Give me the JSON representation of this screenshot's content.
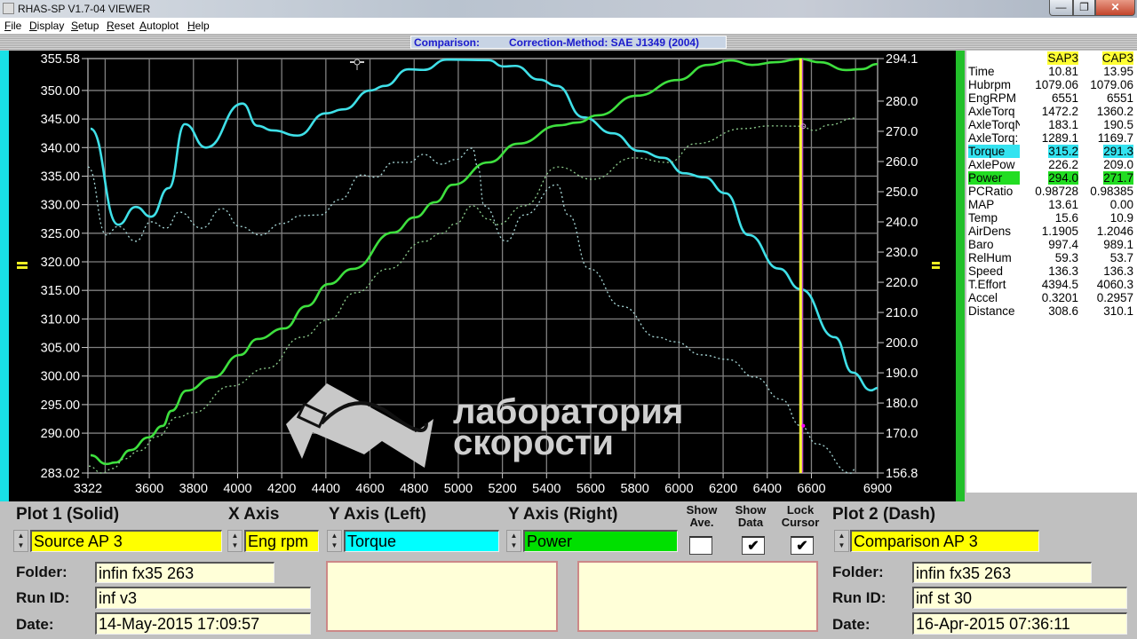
{
  "window": {
    "title": "RHAS-SP V1.7-04  VIEWER",
    "controls": {
      "minimize": "—",
      "restore": "❐",
      "close": "✕"
    }
  },
  "menu": [
    "File",
    "Display",
    "Setup",
    "Reset",
    "Autoplot",
    "Help"
  ],
  "status": {
    "mode": "Comparison:",
    "correction": "Correction-Method: SAE J1349 (2004)"
  },
  "watermark": {
    "line1": "лаборатория",
    "line2": "скорости"
  },
  "table": {
    "headers": [
      "SAP3",
      "CAP3"
    ],
    "rows": [
      {
        "label": "Time",
        "a": "10.81",
        "b": "13.95"
      },
      {
        "label": "Hubrpm",
        "a": "1079.06",
        "b": "1079.06"
      },
      {
        "label": "EngRPM",
        "a": "6551",
        "b": "6551"
      },
      {
        "label": "AxleTorq",
        "a": "1472.2",
        "b": "1360.2"
      },
      {
        "label": "AxleTorqN",
        "a": "183.1",
        "b": "190.5"
      },
      {
        "label": "AxleTorq:",
        "a": "1289.1",
        "b": "1169.7"
      },
      {
        "label": "Torque",
        "a": "315.2",
        "b": "291.3",
        "hl": "cyan"
      },
      {
        "label": "AxlePow",
        "a": "226.2",
        "b": "209.0"
      },
      {
        "label": "Power",
        "a": "294.0",
        "b": "271.7",
        "hl": "green"
      },
      {
        "label": "PCRatio",
        "a": "0.98728",
        "b": "0.98385"
      },
      {
        "label": "MAP",
        "a": "13.61",
        "b": "0.00"
      },
      {
        "label": "Temp",
        "a": "15.6",
        "b": "10.9"
      },
      {
        "label": "AirDens",
        "a": "1.1905",
        "b": "1.2046"
      },
      {
        "label": "Baro",
        "a": "997.4",
        "b": "989.1"
      },
      {
        "label": "RelHum",
        "a": "59.3",
        "b": "53.7"
      },
      {
        "label": "Speed",
        "a": "136.3",
        "b": "136.3"
      },
      {
        "label": "T.Effort",
        "a": "4394.5",
        "b": "4060.3"
      },
      {
        "label": "Accel",
        "a": "0.3201",
        "b": "0.2957"
      },
      {
        "label": "Distance",
        "a": "308.6",
        "b": "310.1"
      }
    ]
  },
  "controls": {
    "plot1_title": "Plot 1 (Solid)",
    "xaxis_title": "X Axis",
    "yleft_title": "Y Axis (Left)",
    "yright_title": "Y Axis (Right)",
    "show_ave_1": "Show",
    "show_ave_2": "Ave.",
    "show_data_1": "Show",
    "show_data_2": "Data",
    "lock_cursor_1": "Lock",
    "lock_cursor_2": "Cursor",
    "plot2_title": "Plot 2 (Dash)",
    "plot1_source": "Source AP 3",
    "xaxis_value": "Eng rpm",
    "yleft_value": "Torque",
    "yright_value": "Power",
    "plot2_source": "Comparison AP 3",
    "show_ave": false,
    "show_data": true,
    "lock_cursor": true,
    "check_mark": "✔",
    "folder_label": "Folder:",
    "runid_label": "Run ID:",
    "date_label": "Date:",
    "plot1": {
      "folder": "infin fx35 263",
      "run_id": "inf v3",
      "date": "14-May-2015  17:09:57"
    },
    "plot2": {
      "folder": "infin fx35 263",
      "run_id": "inf st 30",
      "date": "16-Apr-2015  07:36:11"
    },
    "colors": {
      "plot": "#ffff00",
      "left": "#00ffff",
      "right": "#00e000"
    }
  },
  "chart_data": {
    "type": "line",
    "xlabel": "Eng rpm",
    "ylabel_left": "Torque",
    "ylabel_right": "Power",
    "xlim": [
      3322,
      6900
    ],
    "ylim_left": [
      283.02,
      355.58
    ],
    "ylim_right": [
      156.8,
      294.1
    ],
    "grid": true,
    "cursor_rpm": 6551,
    "x_ticks": [
      3322,
      3600,
      3800,
      4000,
      4200,
      4400,
      4600,
      4800,
      5000,
      5200,
      5400,
      5600,
      5800,
      6000,
      6200,
      6400,
      6600,
      6900
    ],
    "x_grid": [
      3400,
      3600,
      3800,
      4000,
      4200,
      4400,
      4600,
      4800,
      5000,
      5200,
      5400,
      5600,
      5800,
      6000,
      6200,
      6400,
      6600,
      6800
    ],
    "y_left_ticks": [
      "355.58",
      "350.00",
      "345.00",
      "340.00",
      "335.00",
      "330.00",
      "325.00",
      "320.00",
      "315.00",
      "310.00",
      "305.00",
      "300.00",
      "295.00",
      "290.00",
      "283.02"
    ],
    "y_right_ticks": [
      "294.1",
      "280.0",
      "270.0",
      "260.0",
      "250.0",
      "240.0",
      "230.0",
      "220.0",
      "210.0",
      "200.0",
      "190.0",
      "180.0",
      "170.0",
      "156.8"
    ],
    "series": [
      {
        "name": "Torque (Source AP 3)",
        "axis": "left",
        "style": "solid",
        "color": "#3fe0e8",
        "points": [
          [
            3334,
            343.3
          ],
          [
            3459,
            326.5
          ],
          [
            3539,
            329.6
          ],
          [
            3608,
            327.9
          ],
          [
            3688,
            332.9
          ],
          [
            3761,
            344.1
          ],
          [
            3857,
            340.0
          ],
          [
            4022,
            347.7
          ],
          [
            4091,
            343.8
          ],
          [
            4159,
            343.0
          ],
          [
            4272,
            342.1
          ],
          [
            4400,
            346.0
          ],
          [
            4481,
            346.7
          ],
          [
            4602,
            350.0
          ],
          [
            4666,
            350.8
          ],
          [
            4775,
            353.7
          ],
          [
            4843,
            353.6
          ],
          [
            4948,
            355.4
          ],
          [
            5137,
            355.3
          ],
          [
            5205,
            354.2
          ],
          [
            5258,
            354.3
          ],
          [
            5366,
            351.9
          ],
          [
            5447,
            350.8
          ],
          [
            5567,
            345.3
          ],
          [
            5700,
            342.5
          ],
          [
            5821,
            339.4
          ],
          [
            5930,
            338.2
          ],
          [
            6022,
            335.5
          ],
          [
            6115,
            334.8
          ],
          [
            6211,
            332.0
          ],
          [
            6316,
            324.7
          ],
          [
            6453,
            318.8
          ],
          [
            6551,
            315.2
          ],
          [
            6706,
            306.8
          ],
          [
            6787,
            300.6
          ],
          [
            6870,
            297.5
          ],
          [
            6900,
            297.9
          ]
        ]
      },
      {
        "name": "Power (Source AP 3)",
        "axis": "right",
        "style": "solid",
        "color": "#3ee03e",
        "points": [
          [
            3334,
            162.7
          ],
          [
            3406,
            159.8
          ],
          [
            3447,
            160.3
          ],
          [
            3515,
            164.4
          ],
          [
            3596,
            168.6
          ],
          [
            3660,
            172.4
          ],
          [
            3700,
            177.4
          ],
          [
            3769,
            184.1
          ],
          [
            3889,
            188.5
          ],
          [
            4010,
            195.9
          ],
          [
            4091,
            201.2
          ],
          [
            4211,
            204.7
          ],
          [
            4312,
            212.1
          ],
          [
            4413,
            219.4
          ],
          [
            4521,
            224.4
          ],
          [
            4706,
            236.5
          ],
          [
            4803,
            241.5
          ],
          [
            4895,
            246.5
          ],
          [
            4976,
            252.3
          ],
          [
            5137,
            259.7
          ],
          [
            5270,
            265.9
          ],
          [
            5459,
            272.0
          ],
          [
            5539,
            272.9
          ],
          [
            5632,
            275.3
          ],
          [
            5809,
            281.8
          ],
          [
            5994,
            287.0
          ],
          [
            6131,
            292.0
          ],
          [
            6235,
            293.5
          ],
          [
            6332,
            292.0
          ],
          [
            6437,
            292.9
          ],
          [
            6551,
            294.0
          ],
          [
            6638,
            292.9
          ],
          [
            6758,
            290.3
          ],
          [
            6827,
            290.6
          ],
          [
            6900,
            292.3
          ]
        ]
      },
      {
        "name": "Torque (Comparison AP 3)",
        "axis": "left",
        "style": "dash",
        "color": "#a8d8d8",
        "points": [
          [
            3322,
            336.6
          ],
          [
            3406,
            324.7
          ],
          [
            3459,
            326.2
          ],
          [
            3539,
            323.6
          ],
          [
            3608,
            327.0
          ],
          [
            3676,
            325.9
          ],
          [
            3736,
            328.7
          ],
          [
            3837,
            325.9
          ],
          [
            3930,
            329.3
          ],
          [
            4010,
            326.2
          ],
          [
            4103,
            324.7
          ],
          [
            4199,
            326.7
          ],
          [
            4292,
            328.1
          ],
          [
            4372,
            328.2
          ],
          [
            4465,
            330.9
          ],
          [
            4561,
            335.2
          ],
          [
            4626,
            334.8
          ],
          [
            4706,
            337.4
          ],
          [
            4775,
            337.4
          ],
          [
            4843,
            338.8
          ],
          [
            4924,
            337.1
          ],
          [
            4988,
            337.9
          ],
          [
            5064,
            339.9
          ],
          [
            5089,
            336.6
          ],
          [
            5117,
            329.8
          ],
          [
            5217,
            323.6
          ],
          [
            5298,
            328.2
          ],
          [
            5447,
            333.5
          ],
          [
            5499,
            328.2
          ],
          [
            5592,
            318.8
          ],
          [
            5741,
            312.2
          ],
          [
            5901,
            306.8
          ],
          [
            5982,
            306.0
          ],
          [
            6103,
            303.7
          ],
          [
            6223,
            302.9
          ],
          [
            6344,
            299.8
          ],
          [
            6465,
            295.9
          ],
          [
            6551,
            291.3
          ],
          [
            6626,
            288.1
          ],
          [
            6779,
            283.0
          ],
          [
            6799,
            283.8
          ]
        ]
      },
      {
        "name": "Power (Comparison AP 3)",
        "axis": "right",
        "style": "dash",
        "color": "#8fcf8f",
        "points": [
          [
            3326,
            159.1
          ],
          [
            3386,
            156.8
          ],
          [
            3435,
            158.3
          ],
          [
            3487,
            161.5
          ],
          [
            3555,
            164.2
          ],
          [
            3636,
            168.9
          ],
          [
            3728,
            175.3
          ],
          [
            3797,
            176.8
          ],
          [
            3970,
            185.6
          ],
          [
            4131,
            191.5
          ],
          [
            4292,
            201.8
          ],
          [
            4413,
            207.6
          ],
          [
            4533,
            216.5
          ],
          [
            4682,
            224.4
          ],
          [
            4843,
            233.5
          ],
          [
            4924,
            236.2
          ],
          [
            4988,
            239.4
          ],
          [
            5064,
            245.3
          ],
          [
            5137,
            240.9
          ],
          [
            5177,
            239.1
          ],
          [
            5298,
            245.3
          ],
          [
            5451,
            258.2
          ],
          [
            5608,
            254.1
          ],
          [
            5793,
            261.2
          ],
          [
            5953,
            259.7
          ],
          [
            6074,
            265.9
          ],
          [
            6291,
            270.9
          ],
          [
            6412,
            271.8
          ],
          [
            6551,
            271.7
          ],
          [
            6614,
            270.3
          ],
          [
            6678,
            272.1
          ],
          [
            6799,
            274.4
          ]
        ]
      }
    ]
  }
}
